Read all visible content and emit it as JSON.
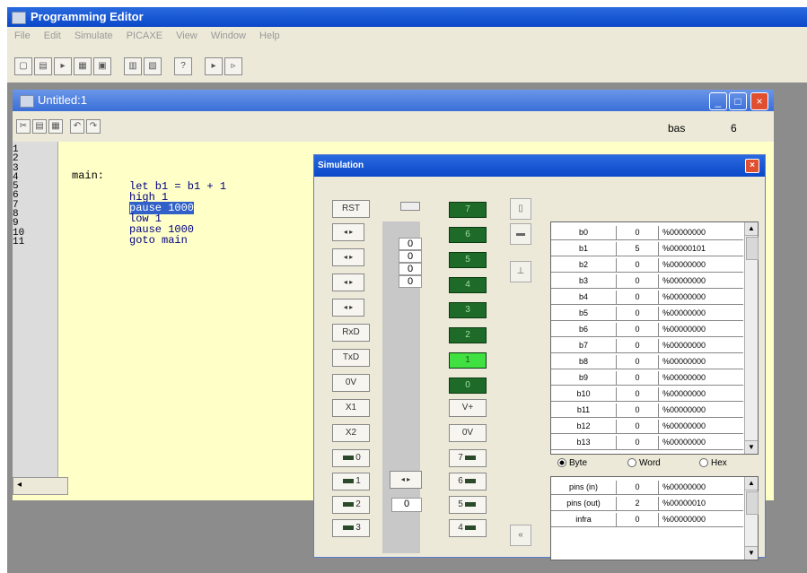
{
  "app": {
    "title": "Programming Editor"
  },
  "menu": [
    "File",
    "Edit",
    "Simulate",
    "PICAXE",
    "View",
    "Window",
    "Help"
  ],
  "editor": {
    "title": "Untitled:1",
    "mode_label": "bas",
    "mode_value": "6",
    "line_numbers": [
      "1",
      "2",
      "3",
      "4",
      "5",
      "6",
      "7",
      "8",
      "9",
      "10",
      "11"
    ],
    "code": {
      "l1": "main:",
      "l2": "let b1 = b1 + 1",
      "l3": "high 1",
      "l4": "pause 1000",
      "l5": "low 1",
      "l6": "pause 1000",
      "l7": "goto main"
    },
    "scroll_left": "◂"
  },
  "sim": {
    "title": "Simulation",
    "close": "×",
    "left_buttons": {
      "rst": "RST",
      "rxd": "RxD",
      "txd": "TxD",
      "ov1": "0V",
      "x1": "X1",
      "x2": "X2"
    },
    "arrow": "◂ ▸",
    "adc_values": [
      "0",
      "0",
      "0",
      "0"
    ],
    "bottom_value": "0",
    "leds": [
      "7",
      "6",
      "5",
      "4",
      "3",
      "2",
      "1",
      "0"
    ],
    "right_buttons": {
      "vplus": "V+",
      "ov2": "0V"
    },
    "pins_left": [
      "0",
      "1",
      "2",
      "3"
    ],
    "pins_right": [
      "7",
      "6",
      "5",
      "4"
    ],
    "side_scroll": "«",
    "reg_rows": [
      {
        "name": "b0",
        "dec": "0",
        "bin": "%00000000"
      },
      {
        "name": "b1",
        "dec": "5",
        "bin": "%00000101"
      },
      {
        "name": "b2",
        "dec": "0",
        "bin": "%00000000"
      },
      {
        "name": "b3",
        "dec": "0",
        "bin": "%00000000"
      },
      {
        "name": "b4",
        "dec": "0",
        "bin": "%00000000"
      },
      {
        "name": "b5",
        "dec": "0",
        "bin": "%00000000"
      },
      {
        "name": "b6",
        "dec": "0",
        "bin": "%00000000"
      },
      {
        "name": "b7",
        "dec": "0",
        "bin": "%00000000"
      },
      {
        "name": "b8",
        "dec": "0",
        "bin": "%00000000"
      },
      {
        "name": "b9",
        "dec": "0",
        "bin": "%00000000"
      },
      {
        "name": "b10",
        "dec": "0",
        "bin": "%00000000"
      },
      {
        "name": "b11",
        "dec": "0",
        "bin": "%00000000"
      },
      {
        "name": "b12",
        "dec": "0",
        "bin": "%00000000"
      },
      {
        "name": "b13",
        "dec": "0",
        "bin": "%00000000"
      }
    ],
    "radio": {
      "byte": "Byte",
      "word": "Word",
      "hex": "Hex"
    },
    "pin_rows": [
      {
        "name": "pins (in)",
        "dec": "0",
        "bin": "%00000000"
      },
      {
        "name": "pins (out)",
        "dec": "2",
        "bin": "%00000010"
      },
      {
        "name": "infra",
        "dec": "0",
        "bin": "%00000000"
      }
    ]
  }
}
